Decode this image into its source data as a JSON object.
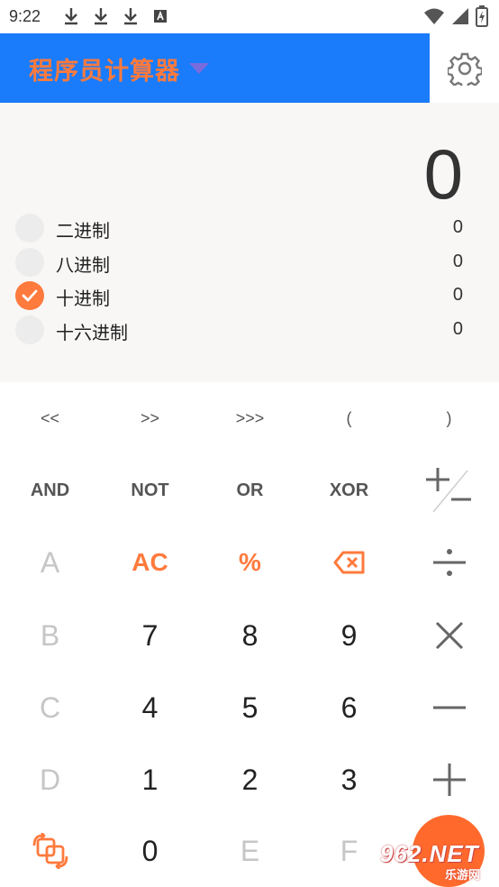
{
  "status_bar": {
    "time": "9:22"
  },
  "header": {
    "title": "程序员计算器"
  },
  "display": {
    "main_value": "0",
    "bases": [
      {
        "label": "二进制",
        "value": "0",
        "checked": false
      },
      {
        "label": "八进制",
        "value": "0",
        "checked": false
      },
      {
        "label": "十进制",
        "value": "0",
        "checked": true
      },
      {
        "label": "十六进制",
        "value": "0",
        "checked": false
      }
    ]
  },
  "keypad": {
    "row1": [
      "<<",
      ">>",
      ">>>",
      "(",
      ")"
    ],
    "row2": [
      "AND",
      "NOT",
      "OR",
      "XOR"
    ],
    "row3": [
      "A",
      "AC",
      "%"
    ],
    "row4": [
      "B",
      "7",
      "8",
      "9"
    ],
    "row5": [
      "C",
      "4",
      "5",
      "6"
    ],
    "row6": [
      "D",
      "1",
      "2",
      "3"
    ],
    "row7": [
      "0",
      "E",
      "F"
    ]
  },
  "watermark": {
    "text": "962.NET",
    "sub": "乐游网"
  },
  "colors": {
    "header": "#1a7cfa",
    "accent": "#ff7a3d"
  }
}
